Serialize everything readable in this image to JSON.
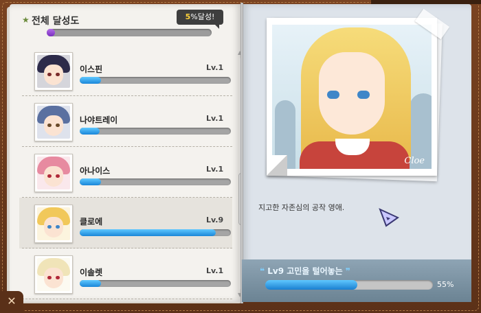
{
  "header": {
    "title": "전체 달성도",
    "badge_value": "5",
    "badge_suffix": "%달성!",
    "overall_progress": 0.05
  },
  "characters": [
    {
      "name": "이스핀",
      "level": "Lv.1",
      "progress": 0.14,
      "hair": "#2d2b4a",
      "eye": "#7a2b2b"
    },
    {
      "name": "나야트레이",
      "level": "Lv.1",
      "progress": 0.13,
      "hair": "#5a70a0",
      "eye": "#6a4a2a"
    },
    {
      "name": "아나이스",
      "level": "Lv.1",
      "progress": 0.14,
      "hair": "#e78aa0",
      "eye": "#b02a3a"
    },
    {
      "name": "클로에",
      "level": "Lv.9",
      "progress": 0.9,
      "hair": "#f1c85a",
      "eye": "#3f86c8"
    },
    {
      "name": "이솔렛",
      "level": "Lv.1",
      "progress": 0.14,
      "hair": "#f0e4b8",
      "eye": "#b02a3a"
    }
  ],
  "selected_index": 3,
  "detail": {
    "signature": "Cloe",
    "description": "지고한 자존심의 공작 영애.",
    "quest_quote_open": "❝",
    "quest_title": "Lv9 고민을 털어놓는",
    "quest_quote_close": "❞",
    "quest_progress": 0.55,
    "quest_percent": "55%"
  },
  "close_label": "✕"
}
